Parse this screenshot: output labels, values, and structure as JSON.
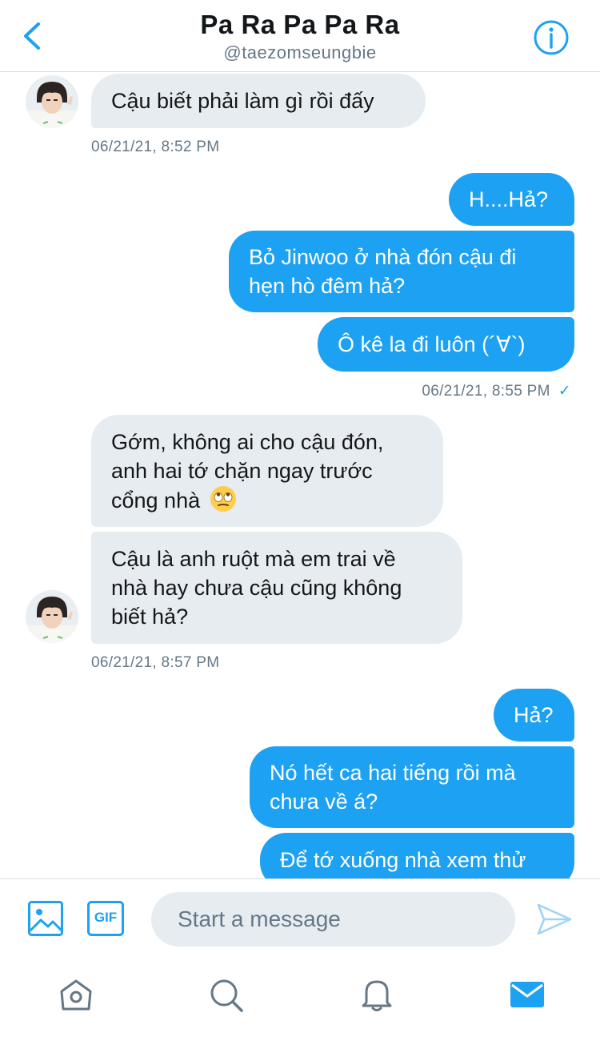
{
  "header": {
    "title": "Pa Ra Pa Pa Ra",
    "handle": "@taezomseungbie"
  },
  "messages": {
    "m1": "Cậu biết phải làm gì rồi đấy",
    "t1": "06/21/21, 8:52 PM",
    "m2": "H....Hả?",
    "m3_line1": "Bỏ Jinwoo ở nhà đón cậu đi",
    "m3_line2": "hẹn hò đêm hả?",
    "m4": "Ô kê la đi luôn (´∀`)",
    "t2": "06/21/21, 8:55 PM",
    "t2_check": "✓",
    "m5_line1": "Gớm, không ai cho cậu đón,",
    "m5_line2": "anh hai tớ chặn ngay trước",
    "m5_line3": "cổng nhà",
    "m6_line1": "Cậu là anh ruột mà em trai về",
    "m6_line2": "nhà hay chưa cậu cũng không",
    "m6_line3": "biết hả?",
    "t3": "06/21/21, 8:57 PM",
    "m7": "Hả?",
    "m8_line1": "Nó hết ca hai tiếng rồi mà",
    "m8_line2": "chưa về á?",
    "m9": "Để tớ xuống nhà xem thử"
  },
  "composer": {
    "placeholder": "Start a message",
    "gif_label": "GIF"
  },
  "icons": {
    "back": "chevron-left-icon",
    "info": "info-icon",
    "image": "image-icon",
    "gif": "gif-icon",
    "send": "send-icon",
    "home": "home-icon",
    "search": "search-icon",
    "notifications": "bell-icon",
    "messages": "mail-icon",
    "emoji": "eye-roll-emoji"
  },
  "colors": {
    "accent": "#1da1f2",
    "incoming_bubble": "#e6ecf0",
    "muted_text": "#657786"
  }
}
